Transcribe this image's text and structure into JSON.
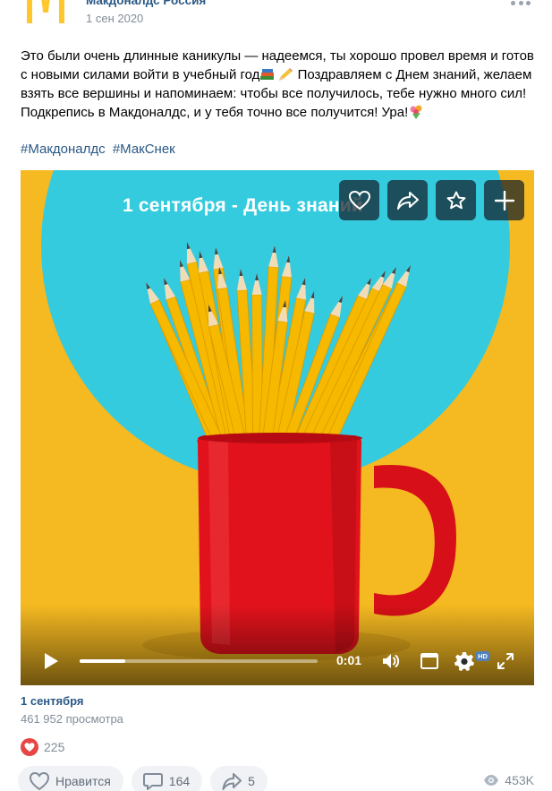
{
  "post": {
    "author": "Макдоналдс Россия",
    "date": "1 сен 2020",
    "text": {
      "line1": "Это были очень длинные каникулы — надеемся, ты хорошо провел время и готов",
      "line2a": "с новыми силами войти в учебный год",
      "line2b": " Поздравляем с Днем знаний, желаем",
      "line3": "взять все вершины и напоминаем: чтобы все получилось, тебе нужно много сил!",
      "line4": "Подкрепись в Макдоналдс, и у тебя точно все получится! Ура!"
    },
    "hashtags": [
      "#Макдоналдс",
      "#МакСнек"
    ]
  },
  "video": {
    "overlay_title": "1 сентября - День знаний",
    "time": "0:01",
    "hd": "HD",
    "progress": 0.19,
    "caption": "1 сентября",
    "views": "461 952 просмотра"
  },
  "reactions": {
    "count": "225"
  },
  "actions": {
    "like_label": "Нравится",
    "comments_count": "164",
    "shares_count": "5",
    "views": "453K"
  },
  "colors": {
    "link": "#2a5885",
    "muted": "#818c99",
    "video_bg": "#f5b921",
    "circle": "#35cbdf",
    "mug": "#e1121b",
    "heart": "#e64646"
  }
}
